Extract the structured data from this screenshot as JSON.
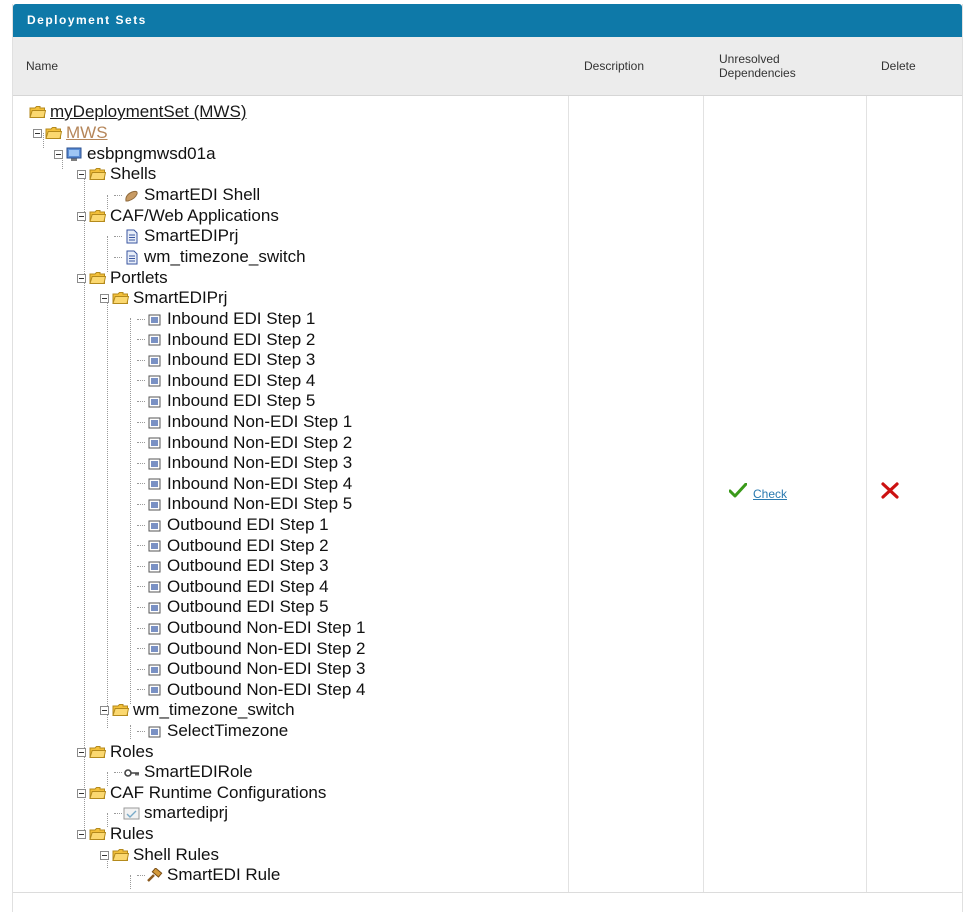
{
  "panel": {
    "title": "Deployment Sets"
  },
  "columns": {
    "name": "Name",
    "description": "Description",
    "unresolved": "Unresolved Dependencies",
    "delete": "Delete"
  },
  "tree": {
    "root": "myDeploymentSet (MWS)",
    "mws": "MWS",
    "server": "esbpngmwsd01a",
    "shells": "Shells",
    "shell_item": "SmartEDI Shell",
    "caf_web": "CAF/Web Applications",
    "caf_web_items": [
      "SmartEDIPrj",
      "wm_timezone_switch"
    ],
    "portlets": "Portlets",
    "portlet_group_1": "SmartEDIPrj",
    "portlet_items": [
      "Inbound EDI Step 1",
      "Inbound EDI Step 2",
      "Inbound EDI Step 3",
      "Inbound EDI Step 4",
      "Inbound EDI Step 5",
      "Inbound Non-EDI Step 1",
      "Inbound Non-EDI Step 2",
      "Inbound Non-EDI Step 3",
      "Inbound Non-EDI Step 4",
      "Inbound Non-EDI Step 5",
      "Outbound EDI Step 1",
      "Outbound EDI Step 2",
      "Outbound EDI Step 3",
      "Outbound EDI Step 4",
      "Outbound EDI Step 5",
      "Outbound Non-EDI Step 1",
      "Outbound Non-EDI Step 2",
      "Outbound Non-EDI Step 3",
      "Outbound Non-EDI Step 4"
    ],
    "portlet_group_2": "wm_timezone_switch",
    "portlet_group_2_item": "SelectTimezone",
    "roles": "Roles",
    "role_item": "SmartEDIRole",
    "caf_runtime": "CAF Runtime Configurations",
    "caf_runtime_item": "smartediprj",
    "rules": "Rules",
    "shell_rules": "Shell Rules",
    "rule_item": "SmartEDI Rule"
  },
  "row": {
    "description": "",
    "check_label": "Check"
  },
  "colors": {
    "titlebar": "#0e79a8",
    "header_bg": "#ececec",
    "check_green": "#3a9a1a",
    "delete_red": "#cc1111",
    "folder": "#f5c542"
  }
}
